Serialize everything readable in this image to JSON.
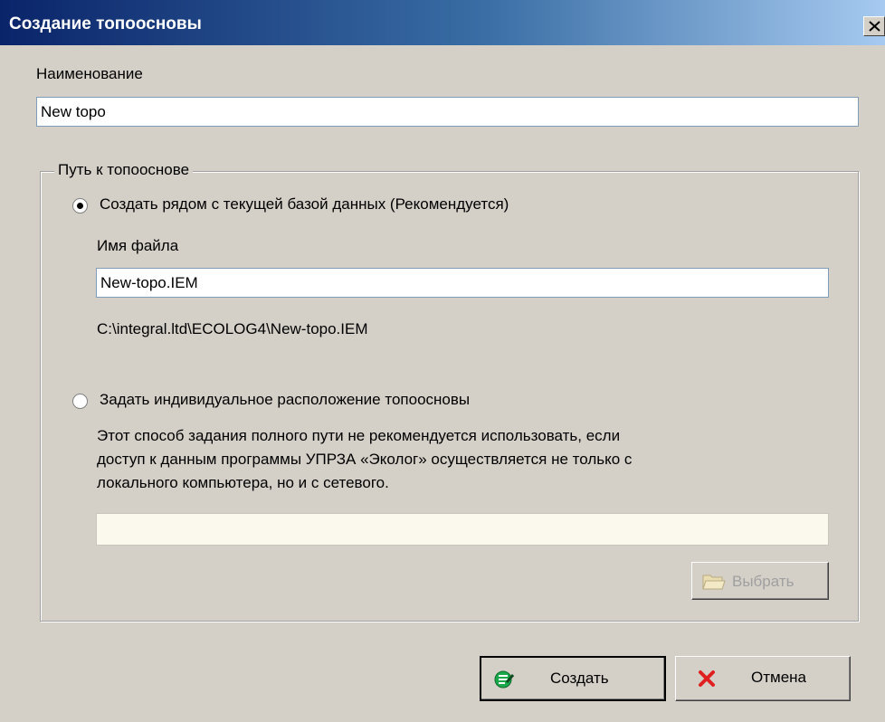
{
  "window": {
    "title": "Создание топоосновы",
    "close_glyph": "X"
  },
  "name_section": {
    "label": "Наименование",
    "value": "New topo"
  },
  "path_group": {
    "legend": "Путь к топооснове",
    "option_near_db": {
      "label": "Создать рядом с текущей базой данных (Рекомендуется)",
      "selected": true,
      "filename_label": "Имя файла",
      "filename_value": "New-topo.IEM",
      "full_path": "C:\\integral.ltd\\ECOLOG4\\New-topo.IEM"
    },
    "option_custom": {
      "label": "Задать индивидуальное расположение топоосновы",
      "selected": false,
      "description_line1": "Этот способ задания полного пути не рекомендуется использовать, если",
      "description_line2": "доступ к данным программы УПРЗА «Эколог» осуществляется не только с",
      "description_line3": "локального компьютера, но и с сетевого.",
      "path_value": "",
      "browse_label": "Выбрать",
      "browse_icon": "folder-open-icon"
    }
  },
  "footer": {
    "create_label": "Создать",
    "create_icon": "create-db-icon",
    "cancel_label": "Отмена",
    "cancel_icon": "red-x-icon"
  },
  "colors": {
    "title_gradient_start": "#0a246a",
    "title_gradient_end": "#a6caf0",
    "dialog_bg": "#d4d0c8",
    "create_icon_green": "#1aa84a",
    "cancel_icon_red": "#e02020"
  }
}
